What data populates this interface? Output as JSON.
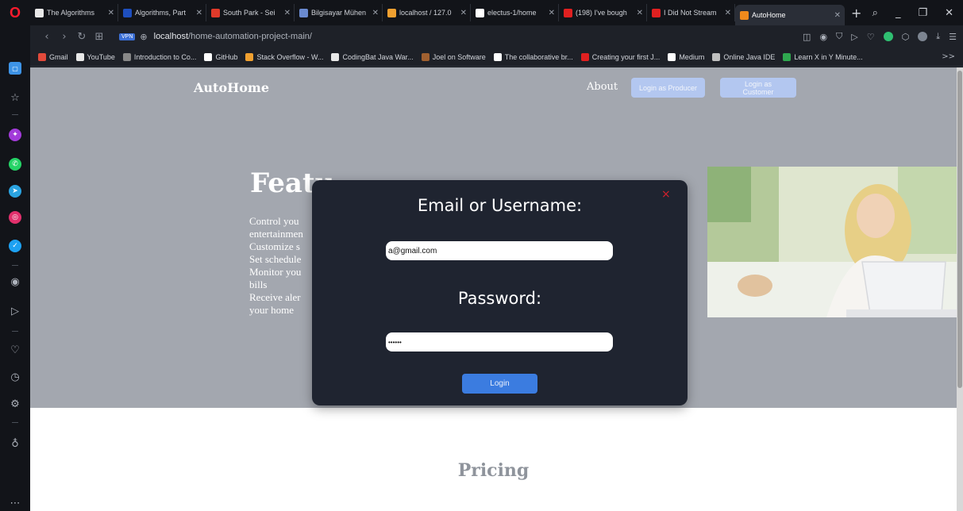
{
  "browser": {
    "tabs": [
      {
        "title": "The Algorithms",
        "favicon_color": "#e8e8e8",
        "active": false
      },
      {
        "title": "Algorithms, Part",
        "favicon_color": "#1e4fbf",
        "active": false
      },
      {
        "title": "South Park - Sei",
        "favicon_color": "#e03a2a",
        "active": false
      },
      {
        "title": "Bilgisayar Mühen",
        "favicon_color": "#6a8ad0",
        "active": false
      },
      {
        "title": "localhost / 127.0",
        "favicon_color": "#f0a030",
        "active": false
      },
      {
        "title": "electus-1/home",
        "favicon_color": "#ffffff",
        "active": false
      },
      {
        "title": "(198) I've bough",
        "favicon_color": "#e02020",
        "active": false
      },
      {
        "title": "I Did Not Stream",
        "favicon_color": "#e02020",
        "active": false
      },
      {
        "title": "AutoHome",
        "favicon_color": "#f08a1c",
        "active": true
      }
    ],
    "new_tab": "+",
    "url_host": "localhost",
    "url_path": "/home-automation-project-main/",
    "vpn_label": "VPN",
    "bookmarks": [
      {
        "label": "Gmail",
        "color": "#e24a3b"
      },
      {
        "label": "YouTube",
        "color": "#e8e8e8"
      },
      {
        "label": "Introduction to Co...",
        "color": "#888888"
      },
      {
        "label": "GitHub",
        "color": "#ffffff"
      },
      {
        "label": "Stack Overflow - W...",
        "color": "#f0a030"
      },
      {
        "label": "CodingBat Java War...",
        "color": "#e8e8e8"
      },
      {
        "label": "Joel on Software",
        "color": "#a06030"
      },
      {
        "label": "The collaborative br...",
        "color": "#ffffff"
      },
      {
        "label": "Creating your first J...",
        "color": "#e02020"
      },
      {
        "label": "Medium",
        "color": "#ffffff"
      },
      {
        "label": "Online Java IDE",
        "color": "#c0c0c0"
      },
      {
        "label": "Learn X in Y Minute...",
        "color": "#2fa84f"
      }
    ],
    "bookmarks_more": ">>"
  },
  "page": {
    "brand": "AutoHome",
    "nav_about": "About",
    "btn_producer": "Login as Producer",
    "btn_customer": "Login as Customer",
    "features_title": "Featu",
    "features_lines": [
      "Control you",
      "entertainmen",
      "Customize s",
      "Set schedule",
      "Monitor you",
      "bills",
      "Receive aler",
      "your home"
    ],
    "pricing_title": "Pricing"
  },
  "modal": {
    "close_symbol": "×",
    "email_label": "Email or Username:",
    "email_value": "a@gmail.com",
    "password_label": "Password:",
    "password_value": "••••••",
    "login_button": "Login"
  },
  "colors": {
    "hero_bg": "#a3a7af",
    "modal_bg": "#1f2430",
    "accent_blue": "#3b7ce0",
    "close_red": "#d4202b"
  }
}
